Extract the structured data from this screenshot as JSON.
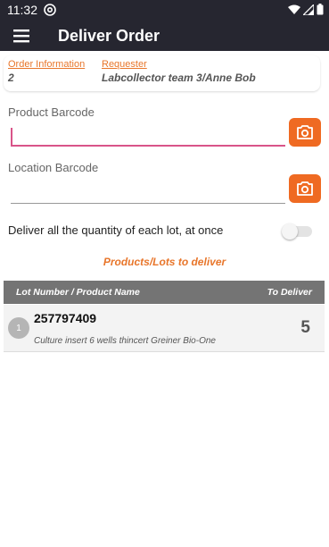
{
  "status_bar": {
    "time": "11:32",
    "icons": [
      "at-sign-icon",
      "wifi-icon",
      "signal-icon",
      "battery-icon"
    ]
  },
  "app_bar": {
    "menu_icon": "hamburger-menu-icon",
    "title": "Deliver Order"
  },
  "order_info": {
    "order_label": "Order Information",
    "order_value": "2",
    "requester_label": "Requester",
    "requester_value": "Labcollector team 3/Anne Bob"
  },
  "product_barcode": {
    "label": "Product Barcode",
    "value": "",
    "camera_icon": "camera-icon"
  },
  "location_barcode": {
    "label": "Location Barcode",
    "value": "",
    "camera_icon": "camera-icon"
  },
  "deliver_all": {
    "label": "Deliver all the quantity of each lot, at once",
    "enabled": false
  },
  "section_title": "Products/Lots to deliver",
  "table": {
    "headers": {
      "lot": "Lot Number / Product Name",
      "to_deliver": "To Deliver"
    },
    "rows": [
      {
        "index": "1",
        "lot_number": "257797409",
        "product_name": "Culture insert 6 wells thincert Greiner Bio-One",
        "to_deliver": "5"
      }
    ]
  },
  "colors": {
    "app_bar": "#262630",
    "accent_orange": "#ef6a22",
    "focus_pink": "#d95489",
    "table_header": "#747474"
  }
}
